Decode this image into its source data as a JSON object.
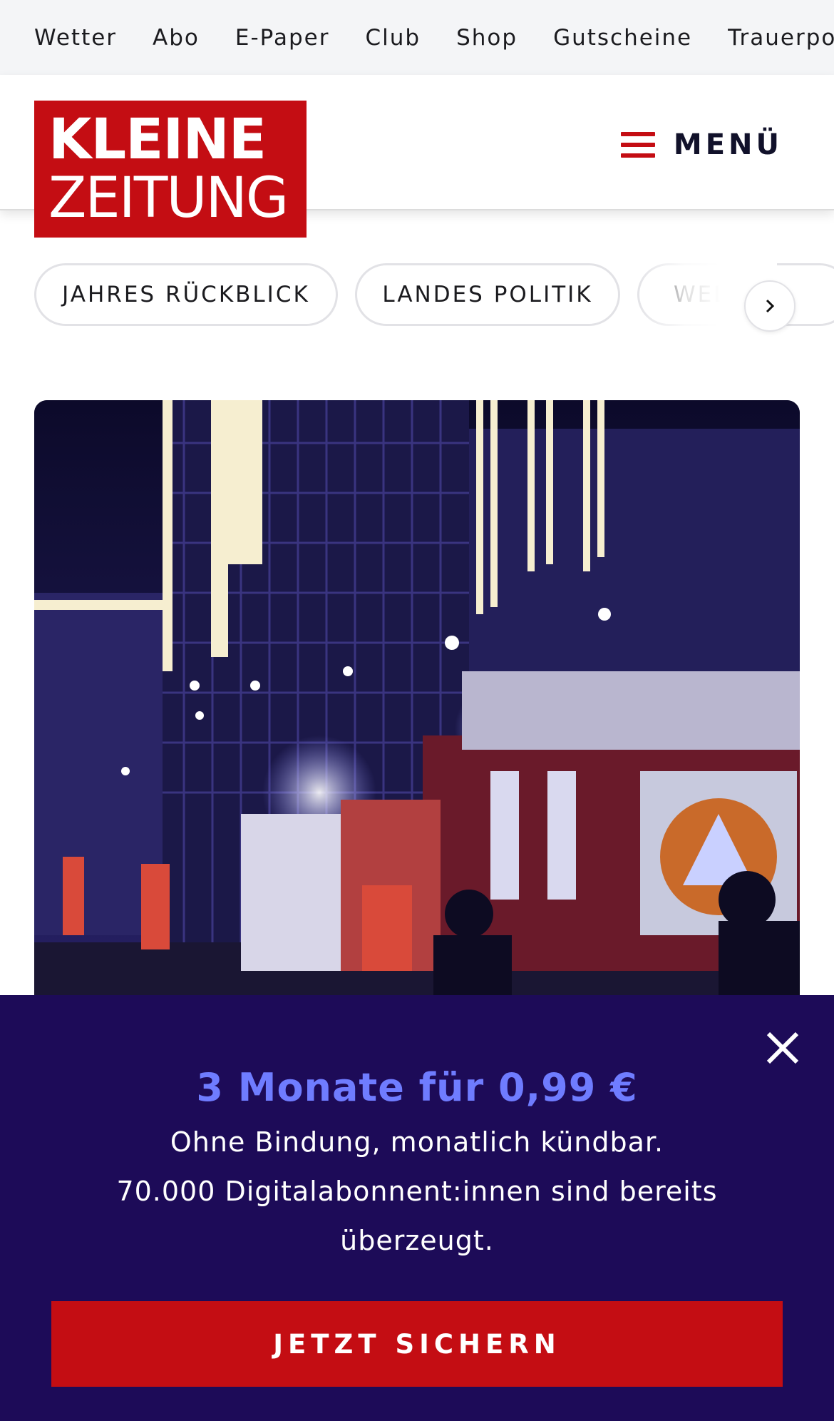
{
  "topnav": {
    "items": [
      "Wetter",
      "Abo",
      "E-Paper",
      "Club",
      "Shop",
      "Gutscheine",
      "Trauerportal"
    ]
  },
  "header": {
    "logo_line1": "KLEINE",
    "logo_line2": "ZEITUNG",
    "menu_label": "MENÜ"
  },
  "chips": {
    "items": [
      "JAHRES RÜCKBLICK",
      "LANDES POLITIK",
      "WELT"
    ]
  },
  "promo": {
    "title": "3 Monate für 0,99 €",
    "line1": "Ohne Bindung, monatlich kündbar.",
    "line2": "70.000 Digitalabonnent:innen sind bereits überzeugt.",
    "cta": "JETZT SICHERN"
  },
  "colors": {
    "brand_red": "#c40d13",
    "promo_bg": "#1d0b58",
    "promo_title": "#6f7cff"
  },
  "icons": {
    "menu": "hamburger-icon",
    "chips_next": "chevron-right-icon",
    "close": "close-icon"
  }
}
